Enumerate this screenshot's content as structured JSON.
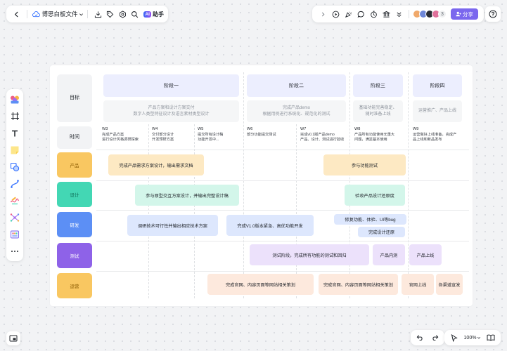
{
  "toolbar": {
    "doc_title": "博思白板文件",
    "ai_badge": "AI",
    "ai_label": "助手"
  },
  "collab": {
    "extra_count": "3",
    "share_label": "分享"
  },
  "zoom": {
    "level": "100%"
  },
  "board": {
    "row_labels": {
      "goal": "目标",
      "time": "时间"
    },
    "stages": [
      {
        "name": "阶段一",
        "desc": [
          "产品方案和设计方案交付",
          "数字人类型特征设计及语言素材类型设计"
        ]
      },
      {
        "name": "阶段二",
        "desc": [
          "完成产品demo",
          "根据用例进行系统化、规范化的测试"
        ]
      },
      {
        "name": "阶段三",
        "desc": [
          "基础功能完善稳定、",
          "随时准备上线"
        ]
      },
      {
        "name": "阶段四",
        "desc": [
          "运营推广、产品上线"
        ]
      }
    ],
    "weeks": [
      {
        "w": "W3",
        "l1": "完成产品方案",
        "l2": "进行设计风格调研探索"
      },
      {
        "w": "W4",
        "l1": "交付部分设计",
        "l2": "开发预研方案"
      },
      {
        "w": "W5",
        "l1": "提交所有设计稿",
        "l2": "功能开发中..."
      },
      {
        "w": "W6",
        "l1": "部分功能提交测试",
        "l2": ""
      },
      {
        "w": "W7",
        "l1": "完成v0.1版产品demo",
        "l2": "产品、设计、测试进行验收"
      },
      {
        "w": "W8",
        "l1": "产品所有功能使用无重大",
        "l2": "问题，满足基本使用"
      },
      {
        "w": "W9",
        "l1": "运营做好上线准备，完成产",
        "l2": "品上线和新品发布"
      }
    ],
    "roles": [
      "产品",
      "设计",
      "研发",
      "测试",
      "运营"
    ],
    "tasks": {
      "product_1": "完成产品需求方案设计，输出需求文档",
      "product_2": "参与功能测试",
      "design_1": "参与原型交互方案设计，并输出完整设计稿",
      "design_2": "验收产品设计还原度",
      "dev_1": "调研技术可行性并输出相应技术方案",
      "dev_2": "完成V1.0版本紧急、高优功能开发",
      "dev_3": "修复功能、体验、UI等bug",
      "dev_4": "完成设计还原",
      "test_1": "测试阶段，完成所有功能的测试和回归",
      "test_2": "产品内测",
      "test_3": "产品上线",
      "ops_1": "完成官网、内容页面等网站相关策划",
      "ops_2": "完成官网、内容页面等网站相关策划",
      "ops_3": "官网上线",
      "ops_4": "各渠道宣发"
    }
  },
  "colors": {
    "accent": "#7b67ee",
    "product": "#f9c761",
    "design": "#43d7b4",
    "dev": "#5c8ff5",
    "test": "#8e62e8",
    "ops": "#f9c761"
  }
}
